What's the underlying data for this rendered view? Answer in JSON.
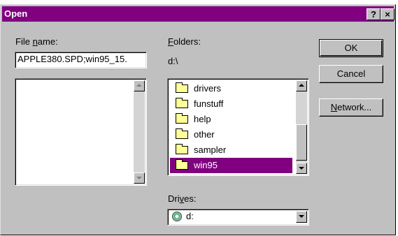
{
  "window": {
    "title": "Open",
    "help_button": "?",
    "close_button": "×"
  },
  "file_name": {
    "label_underlined": "n",
    "label_pre": "File ",
    "label_post": "ame:",
    "value": "APPLE380.SPD;win95_15.",
    "files": []
  },
  "folders": {
    "label_underlined": "F",
    "label_post": "olders:",
    "current_path": "d:\\",
    "items": [
      {
        "label": "drivers",
        "selected": false
      },
      {
        "label": "funstuff",
        "selected": false
      },
      {
        "label": "help",
        "selected": false
      },
      {
        "label": "other",
        "selected": false
      },
      {
        "label": "sampler",
        "selected": false
      },
      {
        "label": "win95",
        "selected": true
      }
    ]
  },
  "drives": {
    "label_pre": "Dri",
    "label_underlined": "v",
    "label_post": "es:",
    "selected": "d:",
    "icon": "cd-drive-icon"
  },
  "buttons": {
    "ok": "OK",
    "cancel": "Cancel",
    "network_underlined": "N",
    "network_post": "etwork..."
  },
  "colors": {
    "titlebar": "#800080",
    "selection": "#800080",
    "face": "#c0c0c0"
  }
}
